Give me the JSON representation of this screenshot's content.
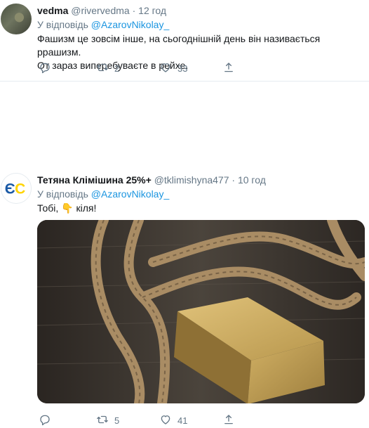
{
  "tweets": [
    {
      "name": "vedma",
      "handle": "@rivervedma",
      "dot": "·",
      "time": "12 год",
      "reply_prefix": "У відповідь",
      "reply_to": "@AzarovNikolay_",
      "text_lines": [
        "Фашизм це зовсім інше, на сьогоднішній день він називається ррашизм.",
        "От зараз виперебуваєте в рейхе."
      ],
      "retweets": "2",
      "likes": "33"
    },
    {
      "name": "Тетяна Клімішина 25%+",
      "handle": "@tklimishyna477",
      "dot": "·",
      "time": "10 год",
      "reply_prefix": "У відповідь",
      "reply_to": "@AzarovNikolay_",
      "text_before": "Тобі,",
      "emoji": "👇",
      "text_after": "кіля!",
      "avatar_text": "ЄС",
      "retweets": "5",
      "likes": "41"
    }
  ],
  "icons": {
    "reply": "reply-icon",
    "retweet": "retweet-icon",
    "like": "heart-icon",
    "share": "share-icon"
  },
  "colors": {
    "link": "#1b95e0",
    "muted": "#657786",
    "avatar_blue": "#1a5aa6",
    "avatar_yellow": "#ffd400"
  }
}
